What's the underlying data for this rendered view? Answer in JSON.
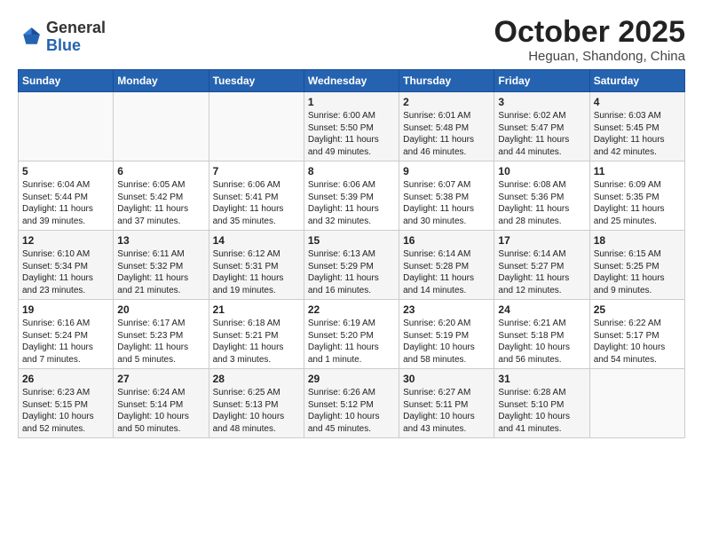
{
  "logo": {
    "text_general": "General",
    "text_blue": "Blue"
  },
  "header": {
    "month": "October 2025",
    "location": "Heguan, Shandong, China"
  },
  "weekdays": [
    "Sunday",
    "Monday",
    "Tuesday",
    "Wednesday",
    "Thursday",
    "Friday",
    "Saturday"
  ],
  "weeks": [
    [
      {
        "day": "",
        "content": ""
      },
      {
        "day": "",
        "content": ""
      },
      {
        "day": "",
        "content": ""
      },
      {
        "day": "1",
        "content": "Sunrise: 6:00 AM\nSunset: 5:50 PM\nDaylight: 11 hours\nand 49 minutes."
      },
      {
        "day": "2",
        "content": "Sunrise: 6:01 AM\nSunset: 5:48 PM\nDaylight: 11 hours\nand 46 minutes."
      },
      {
        "day": "3",
        "content": "Sunrise: 6:02 AM\nSunset: 5:47 PM\nDaylight: 11 hours\nand 44 minutes."
      },
      {
        "day": "4",
        "content": "Sunrise: 6:03 AM\nSunset: 5:45 PM\nDaylight: 11 hours\nand 42 minutes."
      }
    ],
    [
      {
        "day": "5",
        "content": "Sunrise: 6:04 AM\nSunset: 5:44 PM\nDaylight: 11 hours\nand 39 minutes."
      },
      {
        "day": "6",
        "content": "Sunrise: 6:05 AM\nSunset: 5:42 PM\nDaylight: 11 hours\nand 37 minutes."
      },
      {
        "day": "7",
        "content": "Sunrise: 6:06 AM\nSunset: 5:41 PM\nDaylight: 11 hours\nand 35 minutes."
      },
      {
        "day": "8",
        "content": "Sunrise: 6:06 AM\nSunset: 5:39 PM\nDaylight: 11 hours\nand 32 minutes."
      },
      {
        "day": "9",
        "content": "Sunrise: 6:07 AM\nSunset: 5:38 PM\nDaylight: 11 hours\nand 30 minutes."
      },
      {
        "day": "10",
        "content": "Sunrise: 6:08 AM\nSunset: 5:36 PM\nDaylight: 11 hours\nand 28 minutes."
      },
      {
        "day": "11",
        "content": "Sunrise: 6:09 AM\nSunset: 5:35 PM\nDaylight: 11 hours\nand 25 minutes."
      }
    ],
    [
      {
        "day": "12",
        "content": "Sunrise: 6:10 AM\nSunset: 5:34 PM\nDaylight: 11 hours\nand 23 minutes."
      },
      {
        "day": "13",
        "content": "Sunrise: 6:11 AM\nSunset: 5:32 PM\nDaylight: 11 hours\nand 21 minutes."
      },
      {
        "day": "14",
        "content": "Sunrise: 6:12 AM\nSunset: 5:31 PM\nDaylight: 11 hours\nand 19 minutes."
      },
      {
        "day": "15",
        "content": "Sunrise: 6:13 AM\nSunset: 5:29 PM\nDaylight: 11 hours\nand 16 minutes."
      },
      {
        "day": "16",
        "content": "Sunrise: 6:14 AM\nSunset: 5:28 PM\nDaylight: 11 hours\nand 14 minutes."
      },
      {
        "day": "17",
        "content": "Sunrise: 6:14 AM\nSunset: 5:27 PM\nDaylight: 11 hours\nand 12 minutes."
      },
      {
        "day": "18",
        "content": "Sunrise: 6:15 AM\nSunset: 5:25 PM\nDaylight: 11 hours\nand 9 minutes."
      }
    ],
    [
      {
        "day": "19",
        "content": "Sunrise: 6:16 AM\nSunset: 5:24 PM\nDaylight: 11 hours\nand 7 minutes."
      },
      {
        "day": "20",
        "content": "Sunrise: 6:17 AM\nSunset: 5:23 PM\nDaylight: 11 hours\nand 5 minutes."
      },
      {
        "day": "21",
        "content": "Sunrise: 6:18 AM\nSunset: 5:21 PM\nDaylight: 11 hours\nand 3 minutes."
      },
      {
        "day": "22",
        "content": "Sunrise: 6:19 AM\nSunset: 5:20 PM\nDaylight: 11 hours\nand 1 minute."
      },
      {
        "day": "23",
        "content": "Sunrise: 6:20 AM\nSunset: 5:19 PM\nDaylight: 10 hours\nand 58 minutes."
      },
      {
        "day": "24",
        "content": "Sunrise: 6:21 AM\nSunset: 5:18 PM\nDaylight: 10 hours\nand 56 minutes."
      },
      {
        "day": "25",
        "content": "Sunrise: 6:22 AM\nSunset: 5:17 PM\nDaylight: 10 hours\nand 54 minutes."
      }
    ],
    [
      {
        "day": "26",
        "content": "Sunrise: 6:23 AM\nSunset: 5:15 PM\nDaylight: 10 hours\nand 52 minutes."
      },
      {
        "day": "27",
        "content": "Sunrise: 6:24 AM\nSunset: 5:14 PM\nDaylight: 10 hours\nand 50 minutes."
      },
      {
        "day": "28",
        "content": "Sunrise: 6:25 AM\nSunset: 5:13 PM\nDaylight: 10 hours\nand 48 minutes."
      },
      {
        "day": "29",
        "content": "Sunrise: 6:26 AM\nSunset: 5:12 PM\nDaylight: 10 hours\nand 45 minutes."
      },
      {
        "day": "30",
        "content": "Sunrise: 6:27 AM\nSunset: 5:11 PM\nDaylight: 10 hours\nand 43 minutes."
      },
      {
        "day": "31",
        "content": "Sunrise: 6:28 AM\nSunset: 5:10 PM\nDaylight: 10 hours\nand 41 minutes."
      },
      {
        "day": "",
        "content": ""
      }
    ]
  ]
}
